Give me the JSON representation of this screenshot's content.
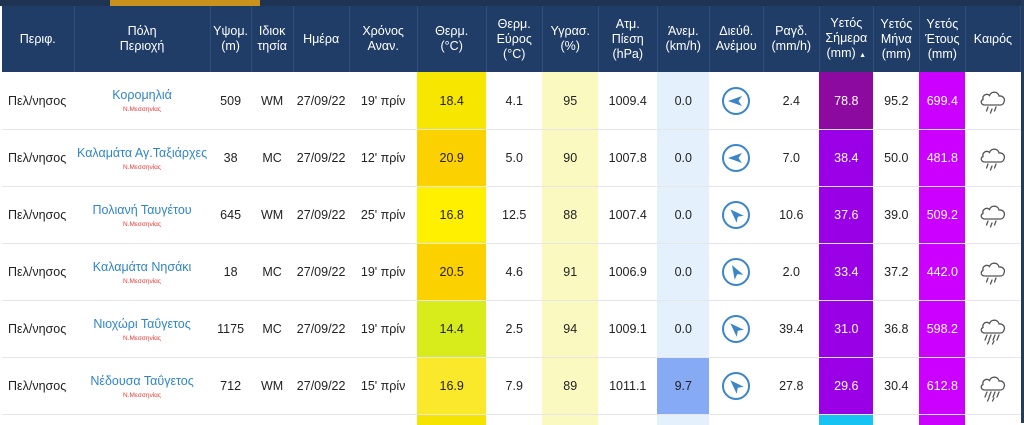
{
  "headers": {
    "region": "Περιφ.",
    "city": [
      "Πόλη",
      "Περιοχή"
    ],
    "altitude": [
      "Υψομ.",
      "(m)"
    ],
    "owner": [
      "Ιδιοκ",
      "τησία"
    ],
    "date": "Ημέρα",
    "update": [
      "Χρόνος",
      "Αναν."
    ],
    "temp": [
      "Θερμ.",
      "(°C)"
    ],
    "temp_range": [
      "Θερμ.",
      "Εύρος",
      "(°C)"
    ],
    "humidity": [
      "Υγρασ.",
      "(%)"
    ],
    "pressure": [
      "Ατμ.",
      "Πίεση",
      "(hPa)"
    ],
    "wind": [
      "Άνεμ.",
      "(km/h)"
    ],
    "wind_dir": [
      "Διεύθ.",
      "Ανέμου"
    ],
    "rain_rate": [
      "Ραγδ.",
      "(mm/h)"
    ],
    "rain_today": [
      "Υετός",
      "Σήμερα",
      "(mm)"
    ],
    "rain_today_sort": "▲",
    "rain_month": [
      "Υετός",
      "Μήνα",
      "(mm)"
    ],
    "rain_year": [
      "Υετός",
      "Έτους",
      "(mm)"
    ],
    "weather": "Καιρός"
  },
  "rows": [
    {
      "region": "Πελ/νησος",
      "city": "Κορομηλιά",
      "sub": "Ν.Μεσσηνίας",
      "alt": "509",
      "owner": "WM",
      "date": "27/09/22",
      "ago": "19' πρίν",
      "temp": "18.4",
      "range": "4.1",
      "hum": "95",
      "press": "1009.4",
      "wind": "0.0",
      "dir_deg": 270,
      "rain_rate": "2.4",
      "today": "78.8",
      "month": "95.2",
      "year": "699.4",
      "icon": "rain-cloud-icon"
    },
    {
      "region": "Πελ/νησος",
      "city": "Καλαμάτα Αγ.Ταξιάρχες",
      "sub": "Ν.Μεσσηνίας",
      "alt": "38",
      "owner": "MC",
      "date": "27/09/22",
      "ago": "12' πρίν",
      "temp": "20.9",
      "range": "5.0",
      "hum": "90",
      "press": "1007.8",
      "wind": "0.0",
      "dir_deg": 270,
      "rain_rate": "7.0",
      "today": "38.4",
      "month": "50.0",
      "year": "481.8",
      "icon": "rain-cloud-icon"
    },
    {
      "region": "Πελ/νησος",
      "city": "Πολιανή Ταυγέτου",
      "sub": "Ν.Μεσσηνίας",
      "alt": "645",
      "owner": "WM",
      "date": "27/09/22",
      "ago": "25' πρίν",
      "temp": "16.8",
      "range": "12.5",
      "hum": "88",
      "press": "1007.4",
      "wind": "0.0",
      "dir_deg": 315,
      "rain_rate": "10.6",
      "today": "37.6",
      "month": "39.0",
      "year": "509.2",
      "icon": "rain-cloud-icon"
    },
    {
      "region": "Πελ/νησος",
      "city": "Καλαμάτα Νησάκι",
      "sub": "Ν.Μεσσηνίας",
      "alt": "18",
      "owner": "MC",
      "date": "27/09/22",
      "ago": "19' πρίν",
      "temp": "20.5",
      "range": "4.6",
      "hum": "91",
      "press": "1006.9",
      "wind": "0.0",
      "dir_deg": 330,
      "rain_rate": "2.0",
      "today": "33.4",
      "month": "37.2",
      "year": "442.0",
      "icon": "rain-cloud-icon"
    },
    {
      "region": "Πελ/νησος",
      "city": "Νιοχώρι Ταΰγετος",
      "sub": "Ν.Μεσσηνίας",
      "alt": "1175",
      "owner": "MC",
      "date": "27/09/22",
      "ago": "19' πρίν",
      "temp": "14.4",
      "range": "2.5",
      "hum": "94",
      "press": "1009.1",
      "wind": "0.0",
      "dir_deg": 315,
      "rain_rate": "39.4",
      "today": "31.0",
      "month": "36.8",
      "year": "598.2",
      "icon": "heavy-rain-cloud-icon"
    },
    {
      "region": "Πελ/νησος",
      "city": "Νέδουσα Ταΰγετος",
      "sub": "Ν.Μεσσηνίας",
      "alt": "712",
      "owner": "WM",
      "date": "27/09/22",
      "ago": "15' πρίν",
      "temp": "16.9",
      "range": "7.9",
      "hum": "89",
      "press": "1011.1",
      "wind": "9.7",
      "dir_deg": 315,
      "rain_rate": "27.8",
      "today": "29.6",
      "month": "30.4",
      "year": "612.8",
      "icon": "heavy-rain-cloud-icon"
    }
  ],
  "colors": {
    "header_bg": "#203d68",
    "city_link": "#2f86c4",
    "sub_red": "#e53935",
    "temp_bg": [
      "#f7e600",
      "#fbd100",
      "#fff000",
      "#fbd100",
      "#d7ec1a",
      "#f9e92a"
    ],
    "hum_bg": "#fafac0",
    "wind_bg": [
      "#e4f0fb",
      "#e4f0fb",
      "#e4f0fb",
      "#e4f0fb",
      "#e4f0fb",
      "#86aaf4"
    ],
    "today_bg": [
      "#8c0aa0",
      "#9900e6",
      "#9900e6",
      "#9900e6",
      "#9900e6",
      "#9900e6"
    ],
    "year_bg": "#cc00ff",
    "partial_temp": "#f4e400",
    "partial_hum": "#fafac0",
    "partial_wind": "#e4f0fb",
    "partial_today": "#17c3f2",
    "partial_year": "#cc00ff"
  }
}
